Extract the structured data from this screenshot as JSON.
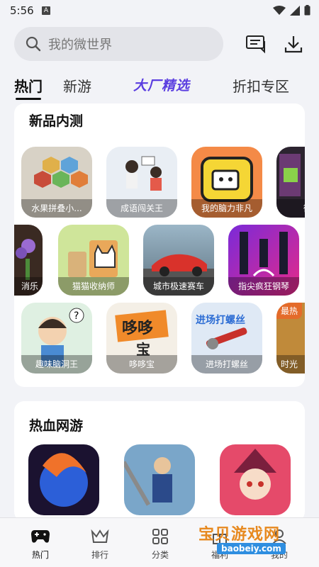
{
  "status": {
    "time": "5:56",
    "a_badge": "A"
  },
  "search": {
    "placeholder": "我的微世界"
  },
  "tabs": [
    {
      "label": "热门"
    },
    {
      "label": "新游"
    },
    {
      "label": "大厂精选"
    },
    {
      "label": "折扣专区"
    }
  ],
  "section_beta": {
    "title": "新品内测",
    "rows": [
      [
        "水果拼叠小...",
        "成语闯关王",
        "我的脑力非凡",
        "微观"
      ],
      [
        "消乐",
        "猫猫收纳师",
        "城市极速赛车",
        "指尖疯狂钢琴"
      ],
      [
        "趣味脑洞王",
        "哆哆宝",
        "进场打螺丝",
        "时光"
      ]
    ],
    "badge": "最热",
    "art_text": {
      "duo": "哆哆",
      "duo_sub": "宝",
      "screw": "进场打螺丝"
    }
  },
  "section_online": {
    "title": "热血网游"
  },
  "bottom_nav": [
    {
      "label": "热门"
    },
    {
      "label": "排行"
    },
    {
      "label": "分类"
    },
    {
      "label": "福利"
    },
    {
      "label": "我的"
    }
  ],
  "watermark": {
    "text": "宝贝游戏网",
    "sub": "baobeiy.com"
  },
  "colors": {
    "accent_tab": "#5a3de0",
    "watermark": "#e7891f"
  }
}
